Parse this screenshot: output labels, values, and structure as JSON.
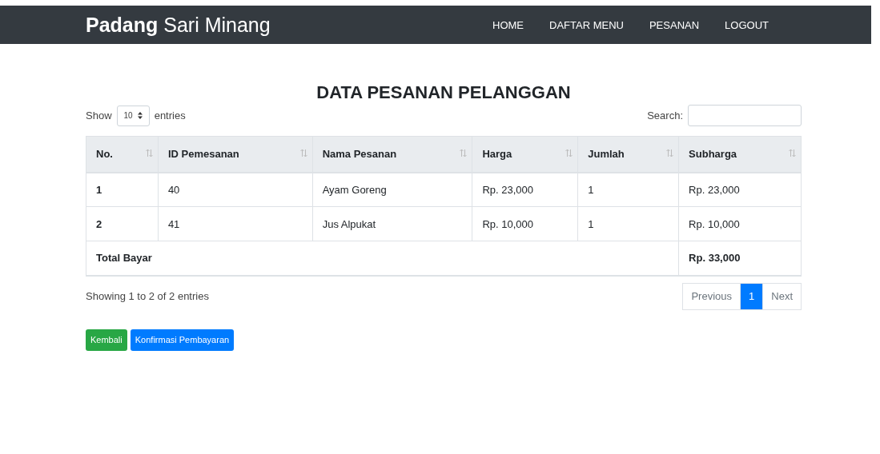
{
  "navbar": {
    "brand": "**Padang** Sari Minang",
    "links": [
      "HOME",
      "DAFTAR MENU",
      "PESANAN",
      "LOGOUT"
    ]
  },
  "title": "DATA PESANAN PELANGGAN",
  "length": {
    "label_before": "Show",
    "value": "10",
    "label_after": "entries"
  },
  "search": {
    "label": "Search:"
  },
  "table": {
    "columns": [
      "No.",
      "ID Pemesanan",
      "Nama Pesanan",
      "Harga",
      "Jumlah",
      "Subharga"
    ],
    "rows": [
      [
        "1",
        "40",
        "Ayam Goreng",
        "Rp. 23,000",
        "1",
        "Rp. 23,000"
      ],
      [
        "2",
        "41",
        "Jus Alpukat",
        "Rp. 10,000",
        "1",
        "Rp. 10,000"
      ]
    ],
    "total": {
      "label": "Total Bayar",
      "value": "Rp. 33,000"
    }
  },
  "info": "Showing 1 to 2 of 2 entries",
  "pagination": [
    {
      "label": "Previous",
      "selected": false,
      "disabled": true
    },
    {
      "label": "1",
      "selected": true,
      "disabled": false
    },
    {
      "label": "Next",
      "selected": false,
      "disabled": true
    }
  ],
  "buttons": [
    {
      "label": "Kembali",
      "kind": "success"
    },
    {
      "label": "Konfirmasi Pembayaran",
      "kind": "primary"
    }
  ]
}
